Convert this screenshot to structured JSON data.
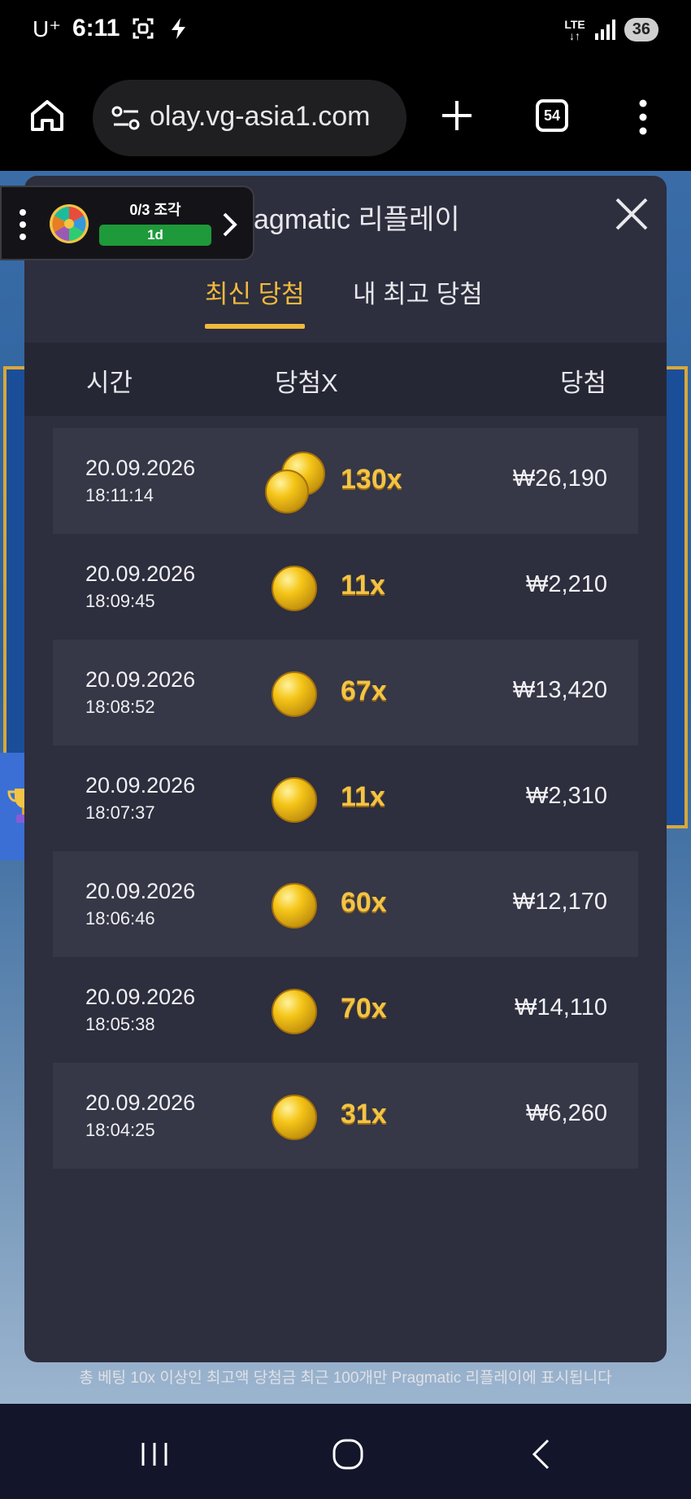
{
  "status_bar": {
    "carrier": "U⁺",
    "time": "6:11",
    "network": "LTE",
    "battery": "36"
  },
  "browser": {
    "url": "olay.vg-asia1.com",
    "tab_count": "54"
  },
  "widget": {
    "pieces": "0/3 조각",
    "timer": "1d"
  },
  "modal": {
    "title": "Pragmatic 리플레이",
    "tabs": [
      {
        "label": "최신 당첨",
        "active": true
      },
      {
        "label": "내 최고 당첨",
        "active": false
      }
    ],
    "columns": {
      "time": "시간",
      "multiplier": "당첨X",
      "win": "당첨"
    },
    "rows": [
      {
        "date": "20.09.2026",
        "time": "18:11:14",
        "multiplier": "130x",
        "win": "₩26,190",
        "coin": "double-coin"
      },
      {
        "date": "20.09.2026",
        "time": "18:09:45",
        "multiplier": "11x",
        "win": "₩2,210",
        "coin": "coin"
      },
      {
        "date": "20.09.2026",
        "time": "18:08:52",
        "multiplier": "67x",
        "win": "₩13,420",
        "coin": "coin"
      },
      {
        "date": "20.09.2026",
        "time": "18:07:37",
        "multiplier": "11x",
        "win": "₩2,310",
        "coin": "coin"
      },
      {
        "date": "20.09.2026",
        "time": "18:06:46",
        "multiplier": "60x",
        "win": "₩12,170",
        "coin": "coin"
      },
      {
        "date": "20.09.2026",
        "time": "18:05:38",
        "multiplier": "70x",
        "win": "₩14,110",
        "coin": "coin"
      },
      {
        "date": "20.09.2026",
        "time": "18:04:25",
        "multiplier": "31x",
        "win": "₩6,260",
        "coin": "coin"
      }
    ],
    "footnote": "총 베팅 10x 이상인 최고액 당첨금 최근 100개만 Pragmatic 리플레이에 표시됩니다"
  },
  "colors": {
    "accent": "#f0b93d",
    "modal_bg": "#2d2e3e",
    "row_alt": "#363747",
    "widget_bar": "#1e9a3a"
  }
}
